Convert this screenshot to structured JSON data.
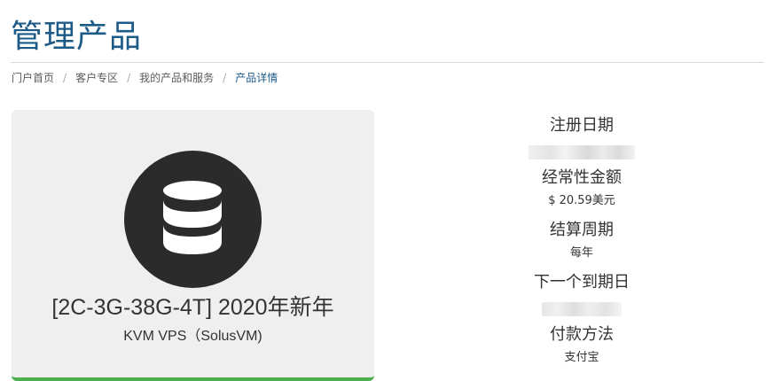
{
  "page": {
    "title": "管理产品"
  },
  "breadcrumb": {
    "items": [
      {
        "label": "门户首页"
      },
      {
        "label": "客户专区"
      },
      {
        "label": "我的产品和服务"
      },
      {
        "label": "产品详情"
      }
    ],
    "separator": "/"
  },
  "product": {
    "icon": "database-icon",
    "name": "[2C-3G-38G-4T] 2020年新年",
    "group": "KVM VPS（SolusVM)",
    "accent_color": "#4cae4c",
    "icon_bg_color": "#2b2b2b"
  },
  "details": {
    "registration_date_label": "注册日期",
    "recurring_amount_label": "经常性金额",
    "recurring_amount_value": "$ 20.59美元",
    "billing_cycle_label": "结算周期",
    "billing_cycle_value": "每年",
    "next_due_date_label": "下一个到期日",
    "payment_method_label": "付款方法",
    "payment_method_value": "支付宝"
  },
  "colors": {
    "title": "#1c5a87",
    "active_crumb": "#1c5a87",
    "panel_bg": "#efefef"
  }
}
